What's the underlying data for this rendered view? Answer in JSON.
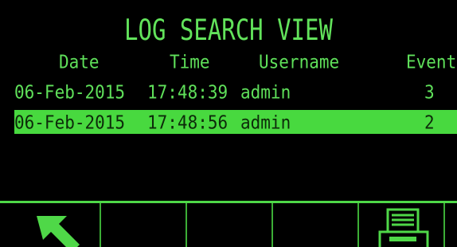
{
  "screen": {
    "title": "LOG SEARCH VIEW"
  },
  "columns": [
    "Date",
    "Time",
    "Username",
    "Event"
  ],
  "rows": [
    {
      "date": "06-Feb-2015",
      "time": "17:48:39",
      "username": "admin",
      "event": "3",
      "selected": false
    },
    {
      "date": "06-Feb-2015",
      "time": "17:48:56",
      "username": "admin",
      "event": "2",
      "selected": true
    }
  ],
  "softkeys": [
    {
      "icon": "back-arrow-icon"
    },
    {
      "icon": ""
    },
    {
      "icon": ""
    },
    {
      "icon": ""
    },
    {
      "icon": "printer-icon"
    },
    {
      "icon": ""
    }
  ],
  "colors": {
    "text": "#5fe05a",
    "selection": "#48d93f",
    "background": "#000000"
  }
}
